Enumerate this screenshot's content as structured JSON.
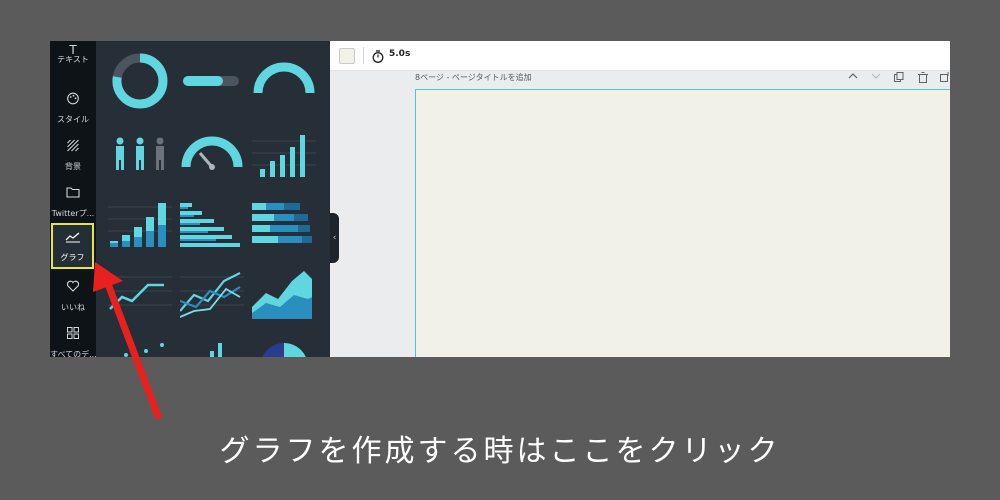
{
  "sidebar": {
    "items": [
      {
        "label": "テキスト",
        "icon": "text-icon"
      },
      {
        "label": "スタイル",
        "icon": "palette-icon"
      },
      {
        "label": "背景",
        "icon": "pattern-icon"
      },
      {
        "label": "Twitterプ...",
        "icon": "folder-icon"
      },
      {
        "label": "グラフ",
        "icon": "chart-line-icon",
        "active": true
      },
      {
        "label": "いいね",
        "icon": "heart-icon"
      },
      {
        "label": "すべてのデ...",
        "icon": "grid-icon"
      }
    ]
  },
  "graph_panel": {
    "tiles": [
      "donut-chart",
      "progress-bar",
      "half-gauge",
      "people-icon-chart",
      "speedometer-gauge",
      "column-chart",
      "column-chart-2",
      "bar-chart",
      "stacked-bar-chart",
      "line-chart",
      "multi-line-chart",
      "area-chart",
      "dot-chart",
      "column-chart-3",
      "pie-chart"
    ]
  },
  "toolbar": {
    "swatch_color": "#f1f1ea",
    "timer_label": "5.0s"
  },
  "page": {
    "label": "8ページ - ページタイトルを追加"
  },
  "annotation": {
    "caption": "グラフを作成する時はここをクリック",
    "highlight_color": "#e3e545",
    "arrow_color": "#e8211f"
  },
  "colors": {
    "accent": "#5fd6e0",
    "accent_dark": "#2a8fbf",
    "background": "#5b5b5b"
  }
}
